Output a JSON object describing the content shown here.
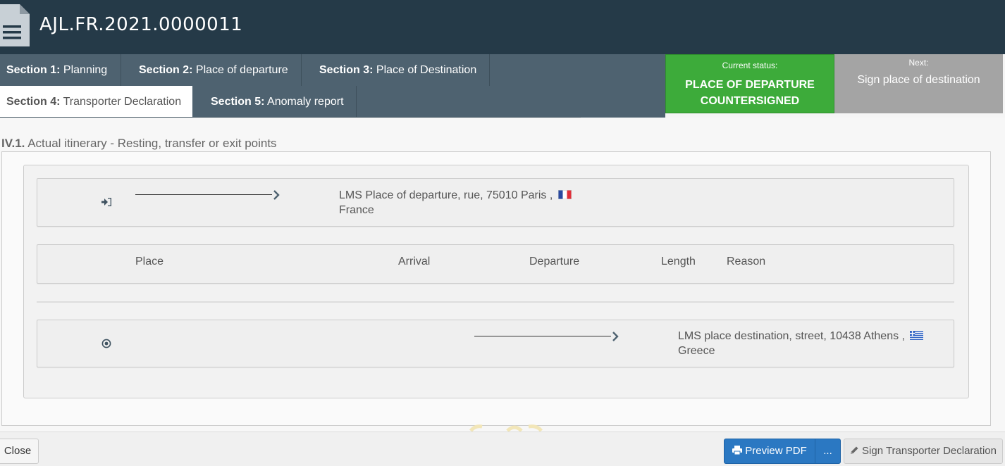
{
  "header": {
    "title": "AJL.FR.2021.0000011",
    "icon": "document-icon"
  },
  "tabs": [
    {
      "num": "Section 1:",
      "label": " Planning",
      "active": false
    },
    {
      "num": "Section 2:",
      "label": " Place of departure",
      "active": false
    },
    {
      "num": "Section 3:",
      "label": " Place of Destination",
      "active": false
    },
    {
      "num": "Section 4:",
      "label": " Transporter Declaration",
      "active": true
    },
    {
      "num": "Section 5:",
      "label": " Anomaly report",
      "active": false
    }
  ],
  "status": {
    "label": "Current status:",
    "value_line1": "PLACE OF DEPARTURE",
    "value_line2": "COUNTERSIGNED",
    "color": "#3dab3a"
  },
  "next": {
    "label": "Next:",
    "value": "Sign place of destination",
    "color": "#a4a4a4"
  },
  "section": {
    "number": "IV.1.",
    "title": " Actual itinerary - Resting, transfer or exit points"
  },
  "departure": {
    "icon": "sign-in-icon",
    "address_line1": "LMS Place of departure, rue, 75010 Paris ,",
    "address_line2": "France",
    "flag": "france-flag-icon"
  },
  "table_header": {
    "place": "Place",
    "arrival": "Arrival",
    "departure": "Departure",
    "length": "Length",
    "reason": "Reason"
  },
  "destination": {
    "icon": "target-icon",
    "address_line1": "LMS place destination, street, 10438 Athens ,",
    "address_line2": "Greece",
    "flag": "greece-flag-icon"
  },
  "footer": {
    "close_label": "Close",
    "preview_label": "Preview PDF",
    "more_label": "...",
    "sign_label": "Sign Transporter Declaration"
  }
}
